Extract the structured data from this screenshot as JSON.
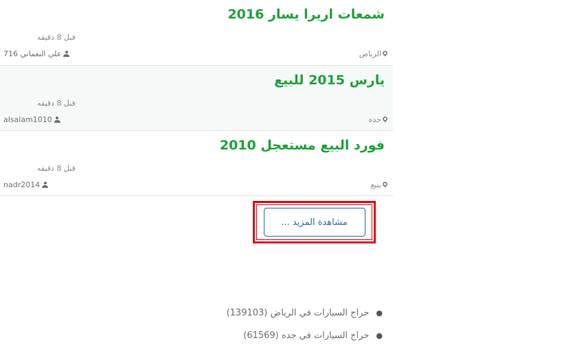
{
  "listings": [
    {
      "title": "شمعات اريرا يسار 2016",
      "time": "قبل 8 دقيقه",
      "user": "علي النعماني 716",
      "city": "الرياض"
    },
    {
      "title": "يارس 2015 للبيع",
      "time": "قبل 8 دقيقه",
      "user": "alsalam1010",
      "city": "جده"
    },
    {
      "title": "فورد البيع مستعجل 2010",
      "time": "قبل 8 دقيقه",
      "user": "nadr2014",
      "city": "ينبع"
    }
  ],
  "more_button": {
    "label": "مشاهدة المزيد ..."
  },
  "links": [
    {
      "label": "حراج السيارات في الرياض (139103)"
    },
    {
      "label": "حراج السيارات في جده (61569)"
    }
  ],
  "colors": {
    "title": "#1fa23a",
    "highlight": "#e8000b",
    "button": "#2e6da4",
    "alt_row": "#f5f9f8"
  },
  "icons": {
    "location": "map-pin-icon",
    "user": "user-icon",
    "bullet": "bullet-icon"
  }
}
